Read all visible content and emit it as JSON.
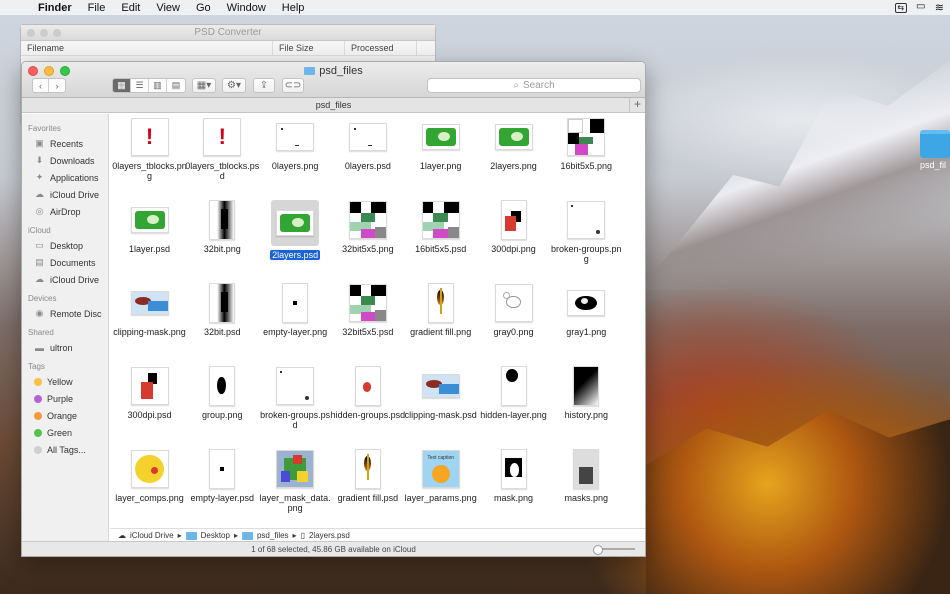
{
  "menubar": {
    "app": "Finder",
    "items": [
      "File",
      "Edit",
      "View",
      "Go",
      "Window",
      "Help"
    ]
  },
  "desktop": {
    "folder_label": "psd_fil"
  },
  "bg_window": {
    "title": "PSD Converter",
    "columns": [
      "Filename",
      "File Size",
      "Processed"
    ]
  },
  "finder": {
    "title": "psd_files",
    "search_placeholder": "Search",
    "path_title": "psd_files",
    "sidebar": {
      "favorites_header": "Favorites",
      "favorites": [
        "Recents",
        "Downloads",
        "Applications",
        "iCloud Drive",
        "AirDrop"
      ],
      "icloud_header": "iCloud",
      "icloud": [
        "Desktop",
        "Documents",
        "iCloud Drive"
      ],
      "devices_header": "Devices",
      "devices": [
        "Remote Disc"
      ],
      "shared_header": "Shared",
      "shared": [
        "ultron"
      ],
      "tags_header": "Tags",
      "tags": [
        {
          "label": "Yellow",
          "color": "#f5c342"
        },
        {
          "label": "Purple",
          "color": "#b063d5"
        },
        {
          "label": "Orange",
          "color": "#f7973a"
        },
        {
          "label": "Green",
          "color": "#56c24a"
        },
        {
          "label": "All Tags...",
          "color": "#d0d0d0"
        }
      ]
    },
    "files": [
      "0layers_tblocks.png",
      "0layers_tblocks.psd",
      "0layers.png",
      "0layers.psd",
      "1layer.png",
      "2layers.png",
      "16bit5x5.png",
      "1layer.psd",
      "32bit.png",
      "2layers.psd",
      "32bit5x5.png",
      "16bit5x5.psd",
      "300dpi.png",
      "broken-groups.png",
      "clipping-mask.png",
      "32bit.psd",
      "empty-layer.png",
      "32bit5x5.psd",
      "gradient fill.png",
      "gray0.png",
      "gray1.png",
      "300dpi.psd",
      "group.png",
      "broken-groups.psd",
      "hidden-groups.psd",
      "clipping-mask.psd",
      "hidden-layer.png",
      "history.png",
      "layer_comps.png",
      "empty-layer.psd",
      "layer_mask_data.png",
      "gradient fill.psd",
      "layer_params.png",
      "mask.png",
      "masks.png"
    ],
    "selected_index": 9,
    "breadcrumb": [
      "iCloud Drive",
      "Desktop",
      "psd_files",
      "2layers.psd"
    ],
    "status": "1 of 68 selected, 45.86 GB available on iCloud",
    "thumb_caption": "Text caption"
  }
}
